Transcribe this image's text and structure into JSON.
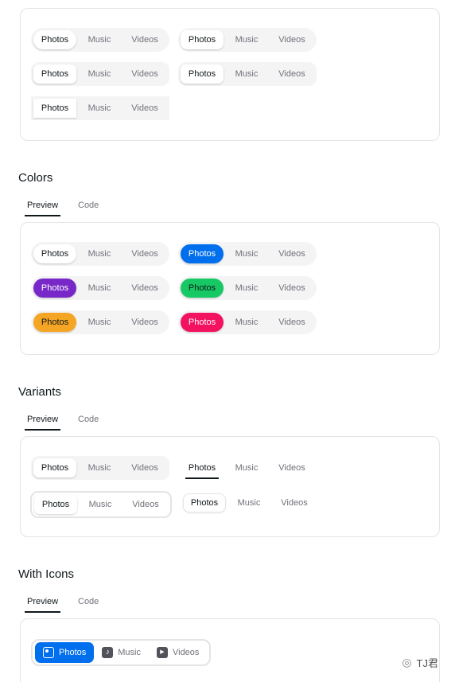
{
  "tab_labels": [
    "Photos",
    "Music",
    "Videos"
  ],
  "sections": {
    "colors": {
      "title": "Colors"
    },
    "variants": {
      "title": "Variants"
    },
    "icons": {
      "title": "With Icons"
    }
  },
  "preview_tabs": {
    "preview": "Preview",
    "code": "Code"
  },
  "color_accents": {
    "primary": "#006fee",
    "secondary": "#7828c8",
    "success": "#17c964",
    "warning": "#f5a524",
    "danger": "#f31260"
  },
  "icon_tabs": [
    {
      "label": "Photos",
      "icon": "gallery-icon"
    },
    {
      "label": "Music",
      "icon": "music-note-icon"
    },
    {
      "label": "Videos",
      "icon": "video-icon"
    }
  ],
  "watermark": "TJ君"
}
